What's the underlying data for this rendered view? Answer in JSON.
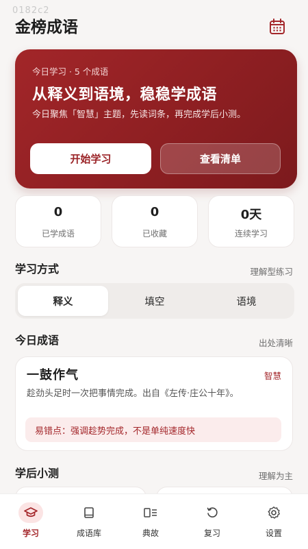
{
  "watermark": "0182c2",
  "app": {
    "title": "金榜成语"
  },
  "header": {
    "calendar_icon": "calendar-icon"
  },
  "hero": {
    "eyebrow": "今日学习 · 5 个成语",
    "headline": "从释义到语境，稳稳学成语",
    "description": "今日聚焦「智慧」主题，先读词条，再完成学后小测。",
    "start_button": "开始学习",
    "list_button": "查看清单",
    "colors": {
      "background": "#9a2226",
      "accent": "#a3262a"
    }
  },
  "stats": [
    {
      "value": "0",
      "label": "已学成语"
    },
    {
      "value": "0",
      "label": "已收藏"
    },
    {
      "value": "0天",
      "label": "连续学习"
    }
  ],
  "study_mode": {
    "title": "学习方式",
    "note": "理解型练习",
    "options": [
      "释义",
      "填空",
      "语境"
    ],
    "selected": "释义"
  },
  "today": {
    "title": "今日成语",
    "note": "出处清晰",
    "idiom": {
      "name": "一鼓作气",
      "tag": "智慧",
      "definition": "趁劲头足时一次把事情完成。出自《左传·庄公十年》。",
      "tip": "易错点：强调趁势完成，不是单纯速度快"
    }
  },
  "quiz": {
    "title": "学后小测",
    "note": "理解为主"
  },
  "tabbar": {
    "items": [
      {
        "label": "学习",
        "icon": "graduation-cap-icon",
        "active": true
      },
      {
        "label": "成语库",
        "icon": "book-icon",
        "active": false
      },
      {
        "label": "典故",
        "icon": "reader-icon",
        "active": false
      },
      {
        "label": "复习",
        "icon": "refresh-icon",
        "active": false
      },
      {
        "label": "设置",
        "icon": "gear-icon",
        "active": false
      }
    ]
  }
}
